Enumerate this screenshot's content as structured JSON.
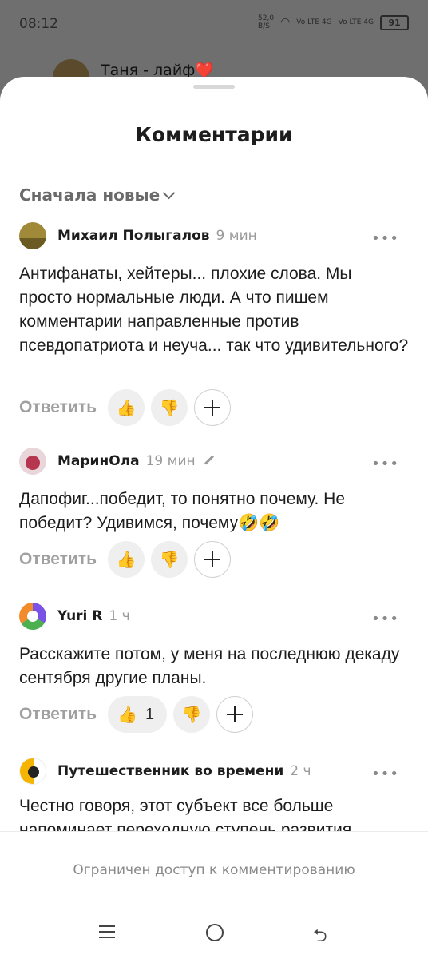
{
  "status_bar": {
    "time": "08:12",
    "net_speed": "52,0",
    "net_unit": "B/S",
    "sim1": "Vo LTE 4G",
    "sim2": "Vo LTE 4G",
    "battery": "91"
  },
  "background_header": {
    "title": "Таня - лайф❤️"
  },
  "sheet": {
    "title": "Комментарии",
    "sort_label": "Сначала новые"
  },
  "comments": [
    {
      "author": "Михаил Полыгалов",
      "time": "9 мин",
      "text": "Антифанаты, хейтеры... плохие слова. Мы просто нормальные люди. А что пишем комментарии направленные против псевдопатриота и неуча... так что удивительного?",
      "reply": "Ответить",
      "like_count": "",
      "avatar_color": "#a08a3a"
    },
    {
      "author": "МаринОла",
      "time": "19 мин",
      "text": "Дапофиг...победит, то понятно почему. Не победит? Удивимся, почему🤣🤣",
      "reply": "Ответить",
      "like_count": "",
      "avatar_color": "#b5364e"
    },
    {
      "author": "Yuri R",
      "time": "1 ч",
      "text": "Расскажите потом, у меня на последнюю декаду сентября другие планы.",
      "reply": "Ответить",
      "like_count": "1",
      "avatar_color": "#7b52e6"
    },
    {
      "author": "Путешественник во времени",
      "time": "2 ч",
      "text": "Честно говоря, этот субъект все больше напоминает переходную ступень развития",
      "avatar_color": "#f4b400"
    }
  ],
  "footer": {
    "restricted": "Ограничен доступ к комментированию"
  },
  "icons": {
    "like": "👍",
    "dislike": "👎",
    "more": "•••",
    "back": "⮌"
  }
}
